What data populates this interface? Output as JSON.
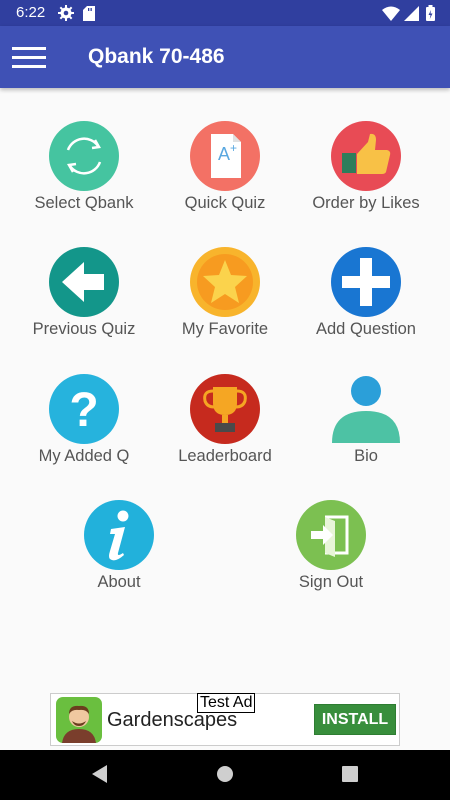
{
  "status_bar": {
    "time": "6:22",
    "icons": [
      "gear-icon",
      "sd-card-icon",
      "wifi-icon",
      "signal-icon",
      "battery-icon"
    ]
  },
  "app_bar": {
    "title": "Qbank 70-486",
    "menu_icon": "hamburger-menu-icon",
    "color": "#3f51b5"
  },
  "grid": {
    "items": [
      {
        "label": "Select Qbank",
        "icon": "refresh-icon",
        "color": "#45c4a0"
      },
      {
        "label": "Quick Quiz",
        "icon": "quiz-document-icon",
        "color": "#f37165"
      },
      {
        "label": "Order by Likes",
        "icon": "thumbs-up-icon",
        "color": "#e84b55"
      },
      {
        "label": "Previous Quiz",
        "icon": "back-arrow-icon",
        "color": "#13968a"
      },
      {
        "label": "My Favorite",
        "icon": "star-icon",
        "color": "#f8b42c"
      },
      {
        "label": "Add Question",
        "icon": "plus-icon",
        "color": "#1976d2"
      },
      {
        "label": "My Added Q",
        "icon": "question-icon",
        "color": "#26b3dd"
      },
      {
        "label": "Leaderboard",
        "icon": "trophy-icon",
        "color": "#c62a1e"
      },
      {
        "label": "Bio",
        "icon": "user-icon",
        "color": "#4dc2a4"
      },
      {
        "label": "About",
        "icon": "info-icon",
        "color": "#22b1db"
      },
      {
        "label": "Sign Out",
        "icon": "sign-out-icon",
        "color": "#7cc051"
      }
    ]
  },
  "ad": {
    "badge": "Test Ad",
    "app_name": "Gardenscapes",
    "install": "INSTALL",
    "icon": "gardenscapes-app-icon"
  },
  "nav_bar": {
    "icons": [
      "back-icon",
      "home-icon",
      "recents-icon"
    ]
  }
}
